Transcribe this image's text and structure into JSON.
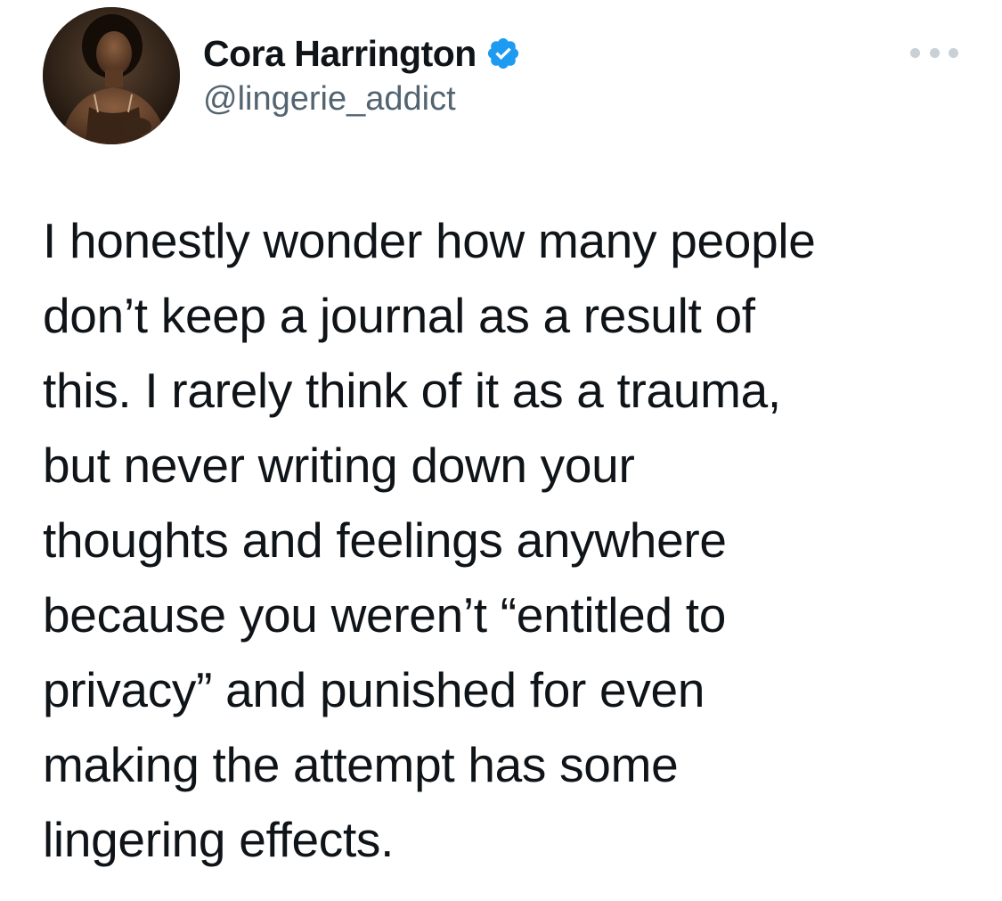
{
  "tweet": {
    "author": {
      "display_name": "Cora Harrington",
      "handle": "@lingerie_addict",
      "verified_icon": "verified-badge-icon",
      "avatar_icon": "profile-photo"
    },
    "more_icon": "more-options-icon",
    "text_lines": [
      "I honestly wonder how many people",
      "don’t keep a journal as a result of",
      "this. I rarely think of it as a trauma,",
      "but never writing down your",
      "thoughts and feelings anywhere",
      "because you weren’t “entitled to",
      "privacy” and punished for even",
      "making the attempt has some",
      "lingering effects."
    ]
  },
  "colors": {
    "text_primary": "#0f1419",
    "text_secondary": "#536471",
    "verified_blue": "#1d9bf0",
    "more_dots": "#c9d0d6",
    "background": "#ffffff"
  }
}
